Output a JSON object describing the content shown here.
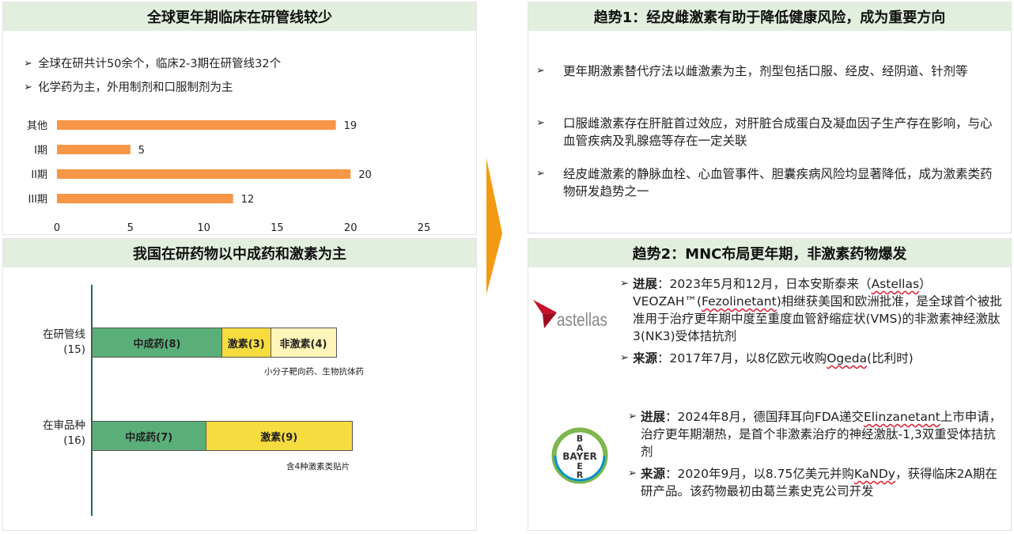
{
  "top_left": {
    "title": "全球更年期临床在研管线较少",
    "bullets": [
      "全球在研共计50余个，临床2-3期在研管线32个",
      "化学药为主，外用制剂和口服制剂为主"
    ]
  },
  "bottom_left": {
    "title": "我国在研药物以中成药和激素为主",
    "rows": [
      {
        "label": "在研管线",
        "sub": "(15)",
        "note": "小分子靶向药、生物抗体药"
      },
      {
        "label": "在审品种",
        "sub": "(16)",
        "note": "含4种激素类贴片"
      }
    ]
  },
  "top_right": {
    "title": "趋势1：经皮雌激素有助于降低健康风险，成为重要方向",
    "bullets": [
      "更年期激素替代疗法以雌激素为主，剂型包括口服、经皮、经阴道、针剂等",
      "口服雌激素存在肝脏首过效应，对肝脏合成蛋白及凝血因子生产存在影响，与心血管疾病及乳腺癌等存在一定关联",
      "经皮雌激素的静脉血栓、心血管事件、胆囊疾病风险均显著降低，成为激素类药物研发趋势之一"
    ]
  },
  "bottom_right": {
    "title": "趋势2：MNC布局更年期，非激素药物爆发",
    "astellas": {
      "logo_text": "astellas",
      "progress_label": "进展",
      "progress_text_1": "：2023年5月和12月，日本安斯泰来（",
      "astellas_word": "Astellas",
      "progress_text_2": "）VEOZAH™(",
      "fezo": "Fezolinetant",
      "progress_text_3": ")相继获美国和欧洲批准，是全球首个被批准用于治疗更年期中度至重度血管舒缩症状(VMS)的非激素神经激肽3(NK3)受体拮抗剂",
      "source_label": "来源",
      "source_text_1": "：2017年7月，以8亿欧元收购",
      "ogeda": "Ogeda",
      "source_text_2": "(比利时)"
    },
    "bayer": {
      "logo_v_top": "B",
      "logo_v_mid": "Y",
      "logo_v_bot": "R",
      "logo_h": "BAYER",
      "progress_label": "进展",
      "progress_text_1": "：2024年8月，德国拜耳向FDA递交",
      "elinz": "Elinzanetant",
      "progress_text_2": "上市申请，治疗更年期潮热，是首个非激素治疗的神经激肽-1,3双重受体拮抗剂",
      "source_label": "来源",
      "source_text_1": "：2020年9月，以8.75亿美元并购",
      "kandy": "KaNDy",
      "source_text_2": "，获得临床2A期在研产品。该药物最初由葛兰素史克公司开发"
    }
  },
  "colors": {
    "bar": "#f79646",
    "green": "#5aaf79",
    "yellow": "#f7dc3f",
    "light_yellow": "#fff5b8",
    "arrow": "#f29b12",
    "axis_line": "#1e6b4a",
    "header_bg": "#e2efdf"
  },
  "chart_data": [
    {
      "type": "bar",
      "orientation": "horizontal",
      "categories": [
        "其他",
        "I期",
        "II期",
        "III期"
      ],
      "values": [
        19,
        5,
        20,
        12
      ],
      "xlim": [
        0,
        25
      ],
      "xticks": [
        0,
        5,
        10,
        15,
        20,
        25
      ],
      "grid": false,
      "legend": "none"
    },
    {
      "type": "bar",
      "orientation": "horizontal",
      "stacked": true,
      "categories": [
        "在研管线(15)",
        "在审品种(16)"
      ],
      "series": [
        {
          "name": "中成药",
          "values": [
            8,
            7
          ]
        },
        {
          "name": "激素",
          "values": [
            3,
            9
          ]
        },
        {
          "name": "非激素",
          "values": [
            4,
            0
          ]
        }
      ],
      "segment_labels": [
        [
          "中成药(8)",
          "激素(3)",
          "非激素(4)"
        ],
        [
          "中成药(7)",
          "激素(9)"
        ]
      ],
      "legend": "none"
    }
  ]
}
